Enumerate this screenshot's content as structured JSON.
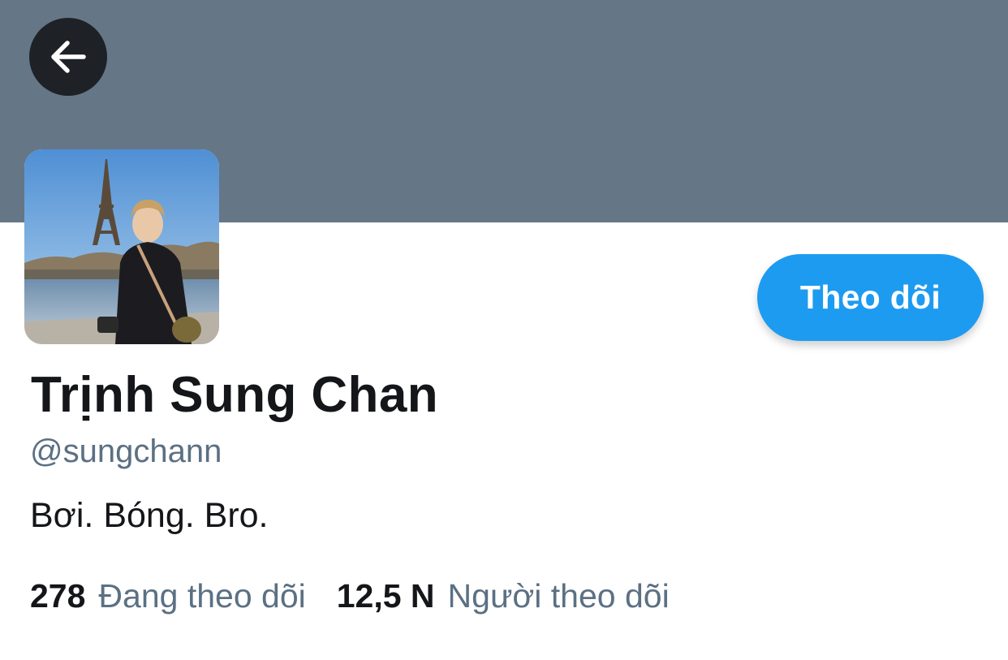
{
  "header": {
    "banner_color": "#657687",
    "back_icon": "arrow-left-icon"
  },
  "profile": {
    "avatar_description_icon": "profile-photo",
    "display_name": "Trịnh Sung Chan",
    "handle": "@sungchann",
    "bio": "Bơi. Bóng. Bro."
  },
  "actions": {
    "follow_label": "Theo dõi",
    "follow_color": "#1d9bf0"
  },
  "stats": {
    "following_count": "278",
    "following_label": "Đang theo dõi",
    "followers_count": "12,5 N",
    "followers_label": "Người theo dõi"
  }
}
